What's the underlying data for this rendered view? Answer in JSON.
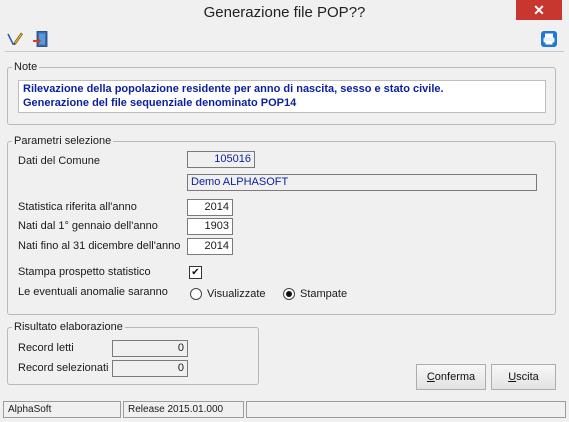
{
  "window": {
    "title": "Generazione file POP??",
    "close_glyph": "✕"
  },
  "toolbar": {
    "icons": [
      "edit-icon",
      "exit-door-icon",
      "print-icon"
    ]
  },
  "note": {
    "legend": "Note",
    "line1": "Rilevazione della popolazione residente per anno di nascita, sesso e stato civile.",
    "line2": "Generazione del file sequenziale denominato POP14"
  },
  "params": {
    "legend": "Parametri selezione",
    "comune_label": "Dati del Comune",
    "comune_code": "105016",
    "comune_name": "Demo ALPHASOFT",
    "anno_label": "Statistica riferita all'anno",
    "anno_value": "2014",
    "nati_dal_label": "Nati dal 1° gennaio dell'anno",
    "nati_dal_value": "1903",
    "nati_fino_label": "Nati fino al 31 dicembre dell'anno",
    "nati_fino_value": "2014",
    "stampa_label": "Stampa prospetto statistico",
    "stampa_checked": true,
    "stampa_mark": "✔",
    "anomalie_label": "Le eventuali anomalie saranno",
    "opt_visualizzate": "Visualizzate",
    "opt_stampate": "Stampate",
    "selected": "Stampate"
  },
  "result": {
    "legend": "Risultato elaborazione",
    "letti_label": "Record letti",
    "letti_value": "0",
    "selezionati_label": "Record selezionati",
    "selezionati_value": "0"
  },
  "buttons": {
    "conferma": "Conferma",
    "uscita": "Uscita"
  },
  "status": {
    "app": "AlphaSoft",
    "release": "Release 2015.01.000",
    "extra": ""
  }
}
